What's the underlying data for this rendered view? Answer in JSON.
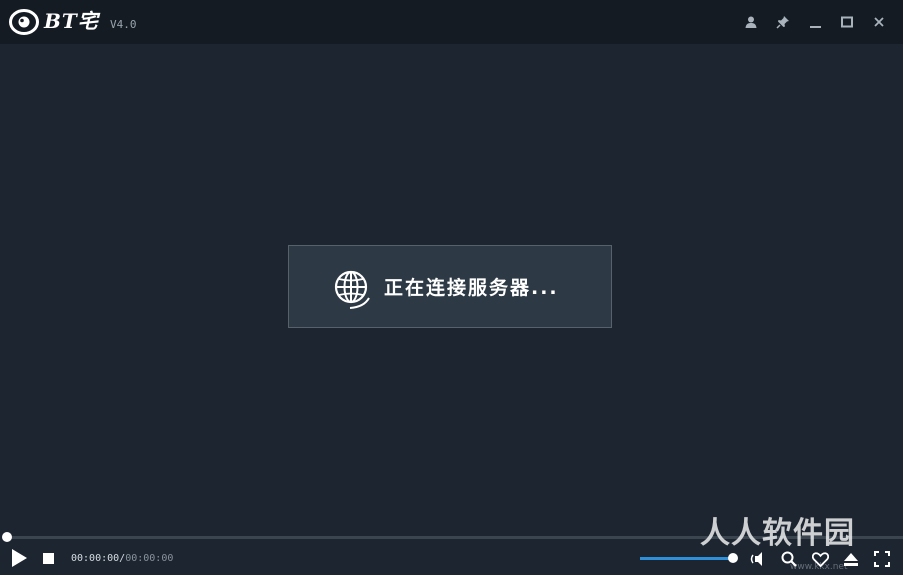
{
  "app": {
    "name": "BT宅",
    "version": "V4.0"
  },
  "titlebar": {
    "icons": [
      "user-icon",
      "pin-icon",
      "minimize-icon",
      "maximize-icon",
      "close-icon"
    ]
  },
  "dialog": {
    "message": "正在连接服务器...",
    "icon": "globe-icon"
  },
  "player": {
    "current_time": "00:00:00",
    "separator": "/",
    "total_time": "00:00:00",
    "progress": 0,
    "volume": 1.0,
    "icons": [
      "play-icon",
      "stop-icon",
      "volume-icon",
      "search-icon",
      "favorite-icon",
      "eject-icon",
      "fullscreen-icon"
    ]
  },
  "watermark": {
    "text": "人人软件园",
    "url": "www.kkx.net"
  },
  "colors": {
    "background": "#1c2530",
    "titlebar": "#141b23",
    "dialog": "#2d3945",
    "accent": "#2f8fd8"
  }
}
